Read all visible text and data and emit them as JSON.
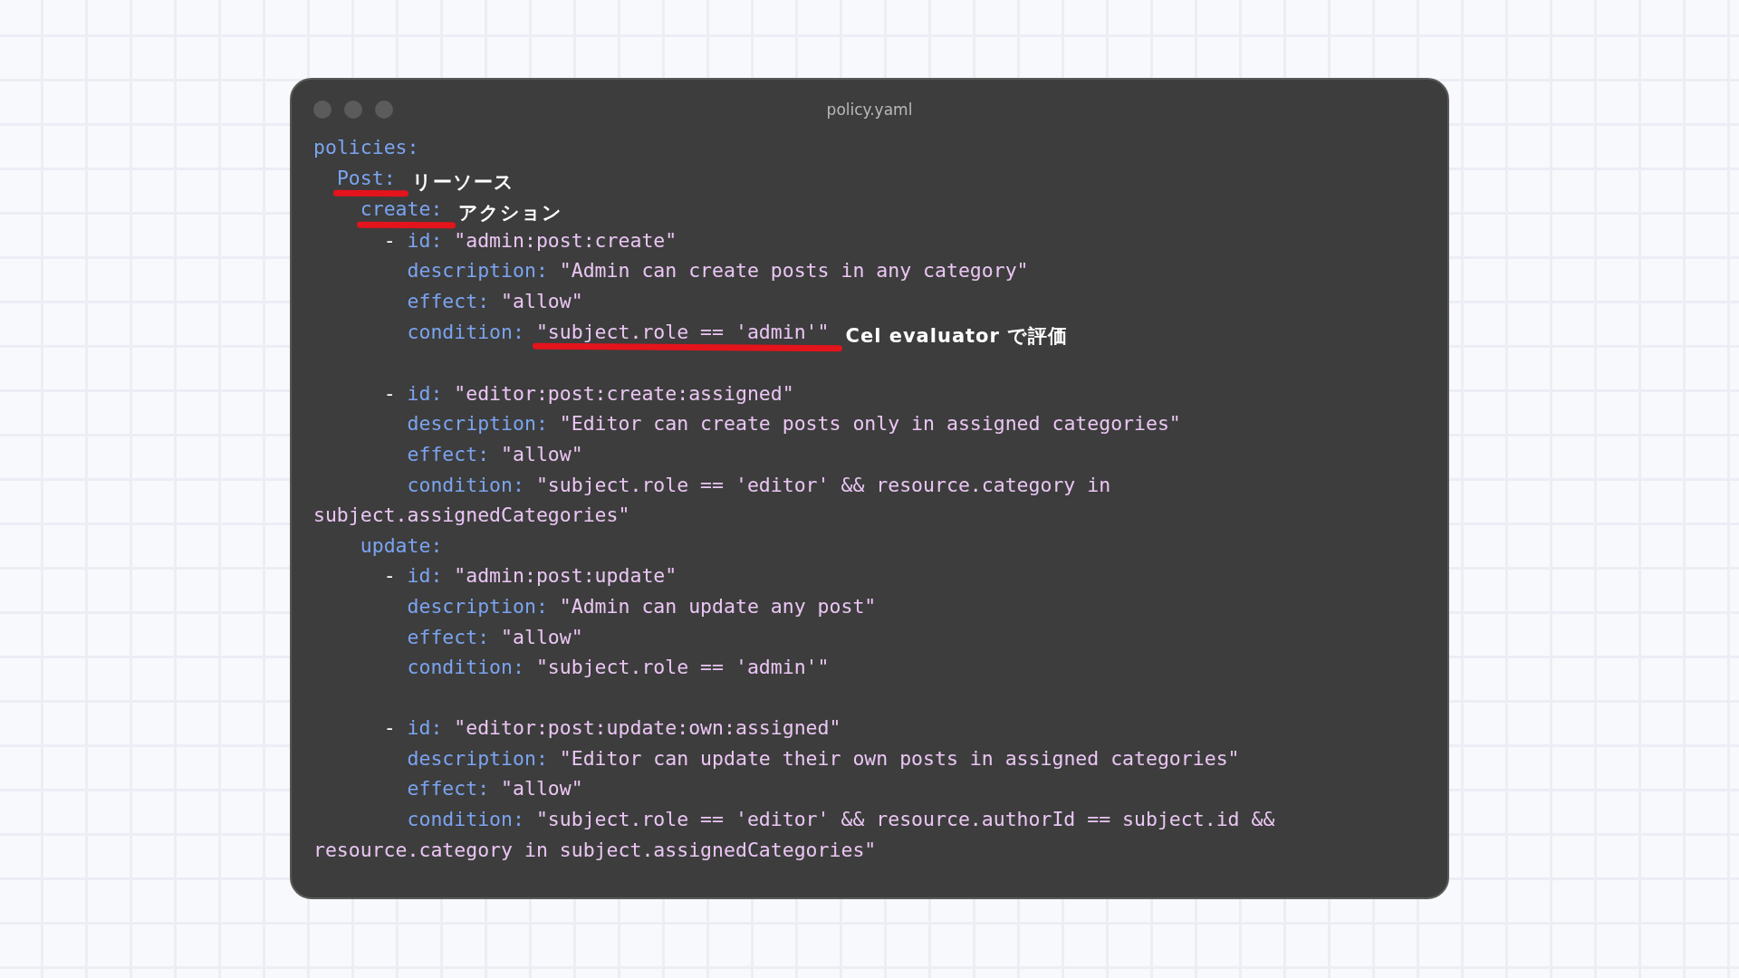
{
  "window": {
    "title": "policy.yaml"
  },
  "code": [
    {
      "kind": "mapping",
      "key": "policies:",
      "children": [
        {
          "kind": "mapping",
          "key": "Post:",
          "key_underlined": true,
          "note": "リーソース",
          "children": [
            {
              "kind": "mapping",
              "key": "create:",
              "key_underlined": true,
              "note": "アクション",
              "children": [
                {
                  "kind": "list-item",
                  "marker": "-",
                  "fields": [
                    {
                      "key": "id:",
                      "value": "\"admin:post:create\""
                    },
                    {
                      "key": "description:",
                      "value": "\"Admin can create posts in any category\""
                    },
                    {
                      "key": "effect:",
                      "value": "\"allow\""
                    },
                    {
                      "key": "condition:",
                      "value": "\"subject.role == 'admin'\"",
                      "value_underlined": true,
                      "note": "Cel evaluator で評価"
                    }
                  ]
                },
                {
                  "kind": "list-item",
                  "marker": "-",
                  "fields": [
                    {
                      "key": "id:",
                      "value": "\"editor:post:create:assigned\""
                    },
                    {
                      "key": "description:",
                      "value": "\"Editor can create posts only in assigned categories\""
                    },
                    {
                      "key": "effect:",
                      "value": "\"allow\""
                    },
                    {
                      "key": "condition:",
                      "value": "\"subject.role == 'editor' && resource.category in",
                      "continuation": "subject.assignedCategories\""
                    }
                  ]
                }
              ]
            },
            {
              "kind": "mapping",
              "key": "update:",
              "children": [
                {
                  "kind": "list-item",
                  "marker": "-",
                  "fields": [
                    {
                      "key": "id:",
                      "value": "\"admin:post:update\""
                    },
                    {
                      "key": "description:",
                      "value": "\"Admin can update any post\""
                    },
                    {
                      "key": "effect:",
                      "value": "\"allow\""
                    },
                    {
                      "key": "condition:",
                      "value": "\"subject.role == 'admin'\""
                    }
                  ]
                },
                {
                  "kind": "list-item",
                  "marker": "-",
                  "fields": [
                    {
                      "key": "id:",
                      "value": "\"editor:post:update:own:assigned\""
                    },
                    {
                      "key": "description:",
                      "value": "\"Editor can update their own posts in assigned categories\""
                    },
                    {
                      "key": "effect:",
                      "value": "\"allow\""
                    },
                    {
                      "key": "condition:",
                      "value": "\"subject.role == 'editor' && resource.authorId == subject.id &&",
                      "continuation": "resource.category in subject.assignedCategories\""
                    }
                  ]
                }
              ]
            }
          ]
        }
      ]
    }
  ]
}
